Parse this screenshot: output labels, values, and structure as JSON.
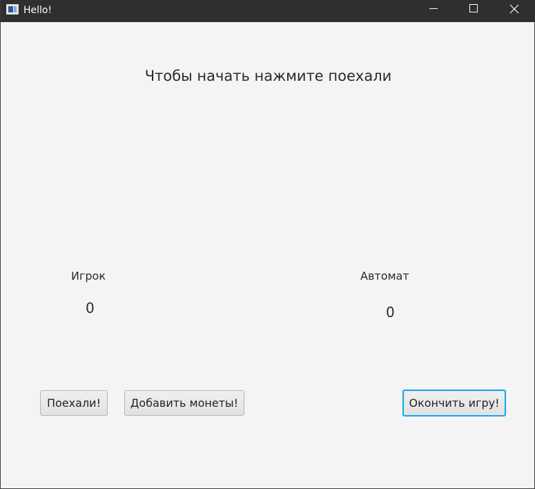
{
  "window": {
    "title": "Hello!",
    "controls": {
      "minimize_icon": "minimize-icon",
      "maximize_icon": "maximize-icon",
      "close_icon": "close-icon"
    }
  },
  "main": {
    "instruction": "Чтобы начать нажмите поехали",
    "player": {
      "label": "Игрок",
      "value": "0"
    },
    "machine": {
      "label": "Автомат",
      "value": "0"
    }
  },
  "buttons": {
    "start_label": "Поехали!",
    "add_coins_label": "Добавить монеты!",
    "end_game_label": "Окончить игру!"
  },
  "colors": {
    "titlebar": "#2f2f2f",
    "background": "#f4f4f4",
    "focus_border": "#1aa3e0"
  }
}
